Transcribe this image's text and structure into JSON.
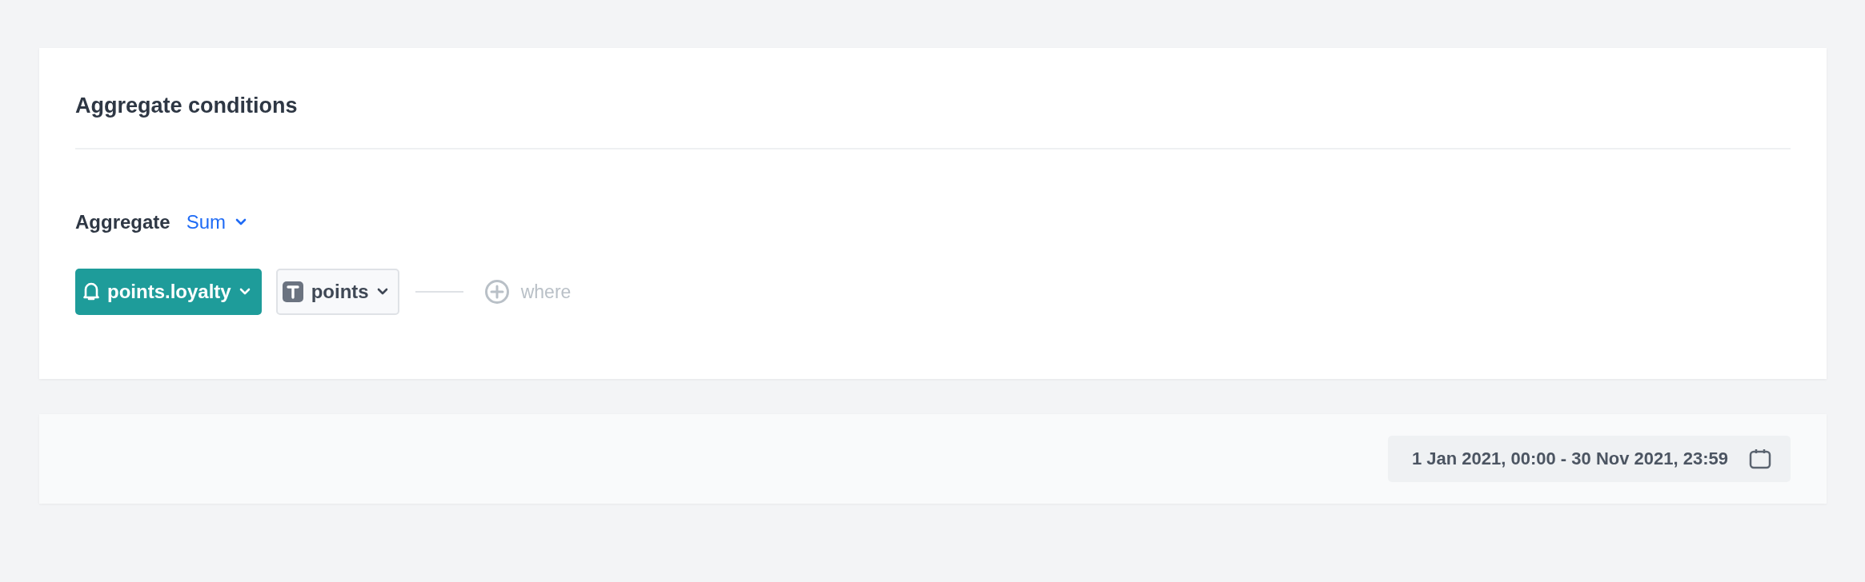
{
  "card": {
    "title": "Aggregate conditions"
  },
  "aggregate": {
    "label": "Aggregate",
    "value": "Sum"
  },
  "event": {
    "label": "points.loyalty"
  },
  "attribute": {
    "label": "points"
  },
  "where": {
    "label": "where",
    "disabled": true
  },
  "date_range": {
    "label": "1 Jan 2021, 00:00 - 30 Nov 2021, 23:59"
  }
}
